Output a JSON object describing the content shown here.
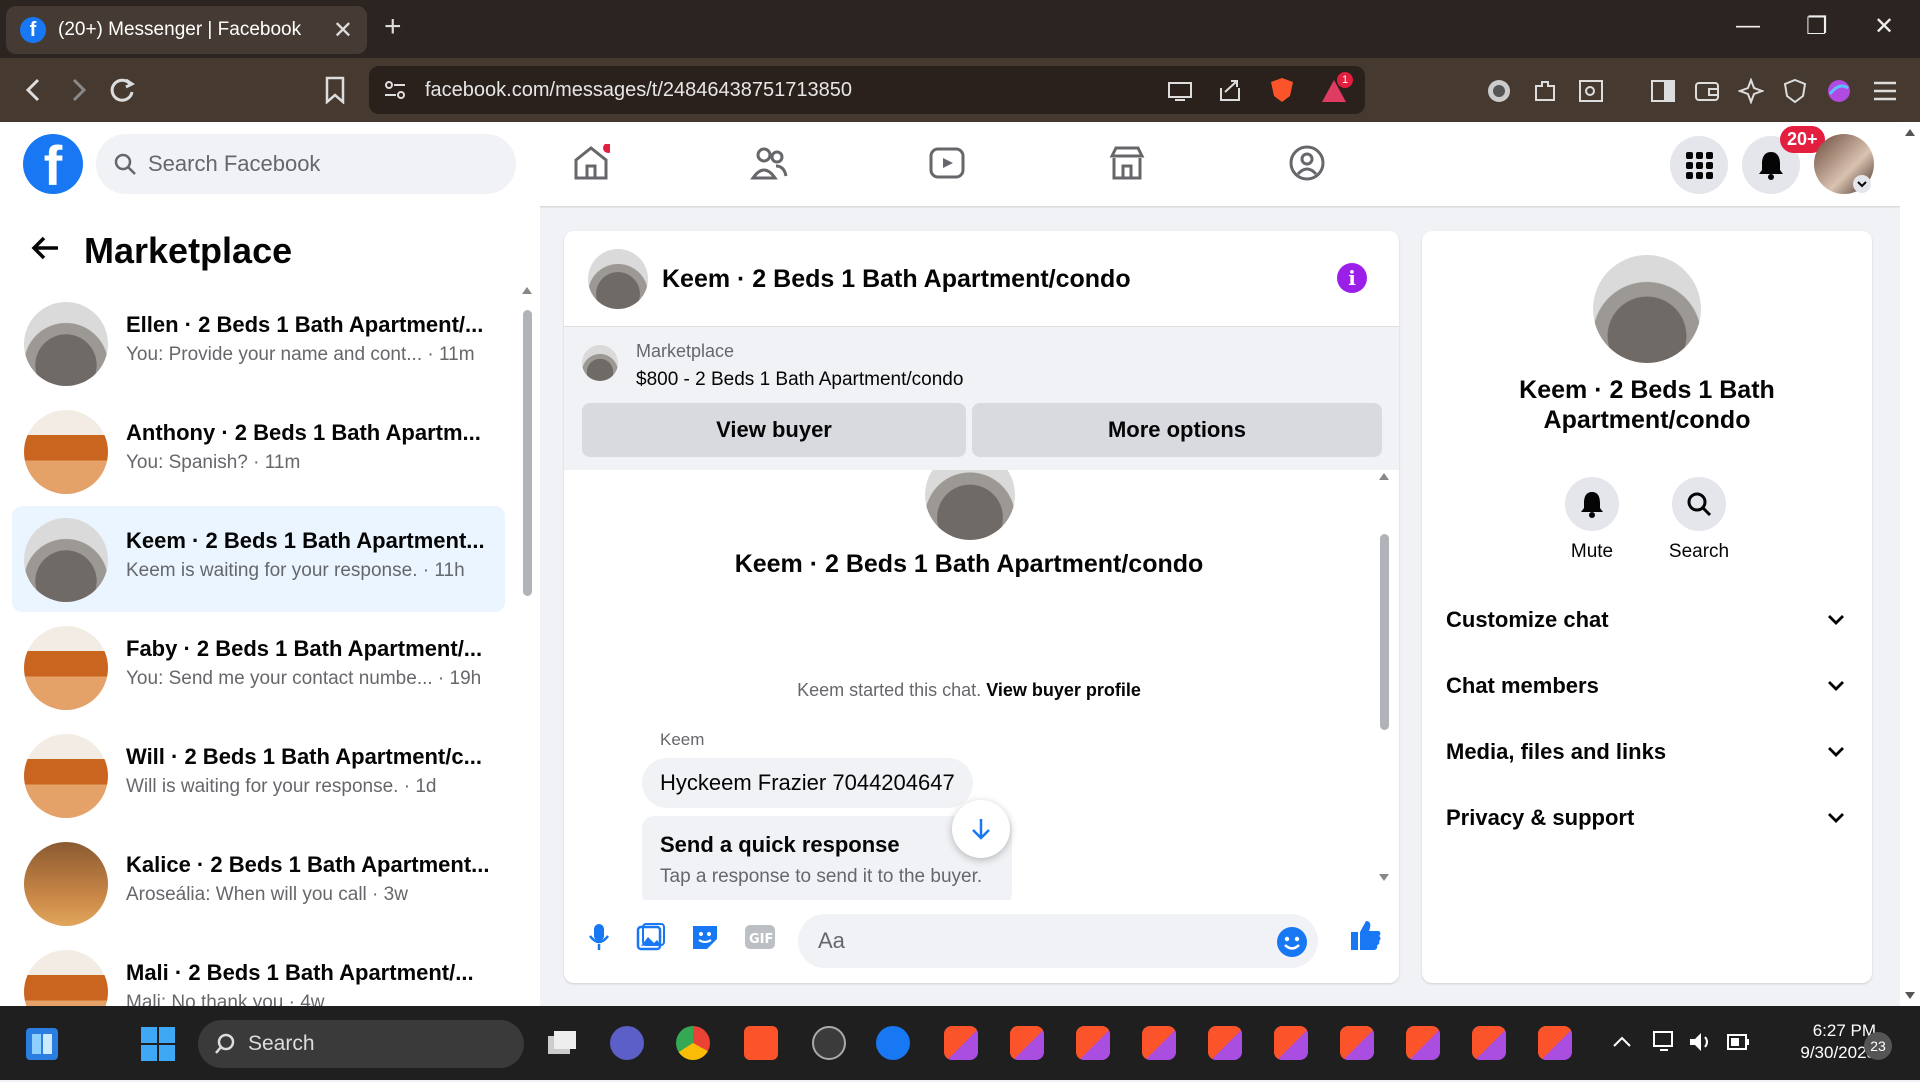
{
  "browser": {
    "tab_title": "(20+) Messenger | Facebook",
    "tab_favicon": "f",
    "url_domain": "facebook.com",
    "url_path": "/messages/t/24846438751713850",
    "new_tab": "+",
    "tab_close": "✕",
    "minimize": "—",
    "maximize": "❐",
    "close": "✕",
    "brave_badge": "1"
  },
  "fb": {
    "logo": "f",
    "search_placeholder": "Search Facebook",
    "notif_badge": "20+"
  },
  "left": {
    "title": "Marketplace",
    "conversations": [
      {
        "name": "Ellen · 2 Beds 1 Bath Apartment/...",
        "snippet": "You: Provide your name and cont... · 11m",
        "thumb": "gray"
      },
      {
        "name": "Anthony · 2 Beds 1 Bath Apartm...",
        "snippet": "You: Spanish? · 11m",
        "thumb": "orange"
      },
      {
        "name": "Keem · 2 Beds 1 Bath Apartment...",
        "snippet": "Keem is waiting for your response. · 11h",
        "thumb": "gray"
      },
      {
        "name": "Faby · 2 Beds 1 Bath Apartment/...",
        "snippet": "You: Send me your contact numbe... · 19h",
        "thumb": "orange"
      },
      {
        "name": "Will · 2 Beds 1 Bath Apartment/c...",
        "snippet": "Will is waiting for your response. · 1d",
        "thumb": "orange"
      },
      {
        "name": "Kalice · 2 Beds 1 Bath Apartment...",
        "snippet": "Aroseália: When will you call · 3w",
        "thumb": "brown"
      },
      {
        "name": "Mali · 2 Beds 1 Bath Apartment/...",
        "snippet": "Mali: No thank you · 4w",
        "thumb": "orange"
      }
    ]
  },
  "chat": {
    "title": "Keem · 2 Beds 1 Bath Apartment/condo",
    "info": "i",
    "marketplace_label": "Marketplace",
    "listing": "$800 - 2 Beds 1 Bath Apartment/condo",
    "view_buyer": "View buyer",
    "more_options": "More options",
    "thread_title": "Keem · 2 Beds 1 Bath Apartment/condo",
    "started_text": "Keem started this chat.",
    "view_buyer_profile": "View buyer profile",
    "sender": "Keem",
    "message": "Hyckeem Frazier 7044204647",
    "quick_title": "Send a quick response",
    "quick_sub": "Tap a response to send it to the buyer.",
    "input_placeholder": "Aa"
  },
  "right": {
    "name": "Keem · 2 Beds 1 Bath Apartment/condo",
    "mute": "Mute",
    "search": "Search",
    "sections": [
      "Customize chat",
      "Chat members",
      "Media, files and links",
      "Privacy & support"
    ]
  },
  "taskbar": {
    "search": "Search",
    "time": "6:27 PM",
    "date": "9/30/2025",
    "notifications": "23"
  },
  "colors": {
    "fb_blue": "#1877f2",
    "active_conv": "#ebf5ff",
    "badge_red": "#e41e3f",
    "info_purple": "#9b1fe8"
  }
}
